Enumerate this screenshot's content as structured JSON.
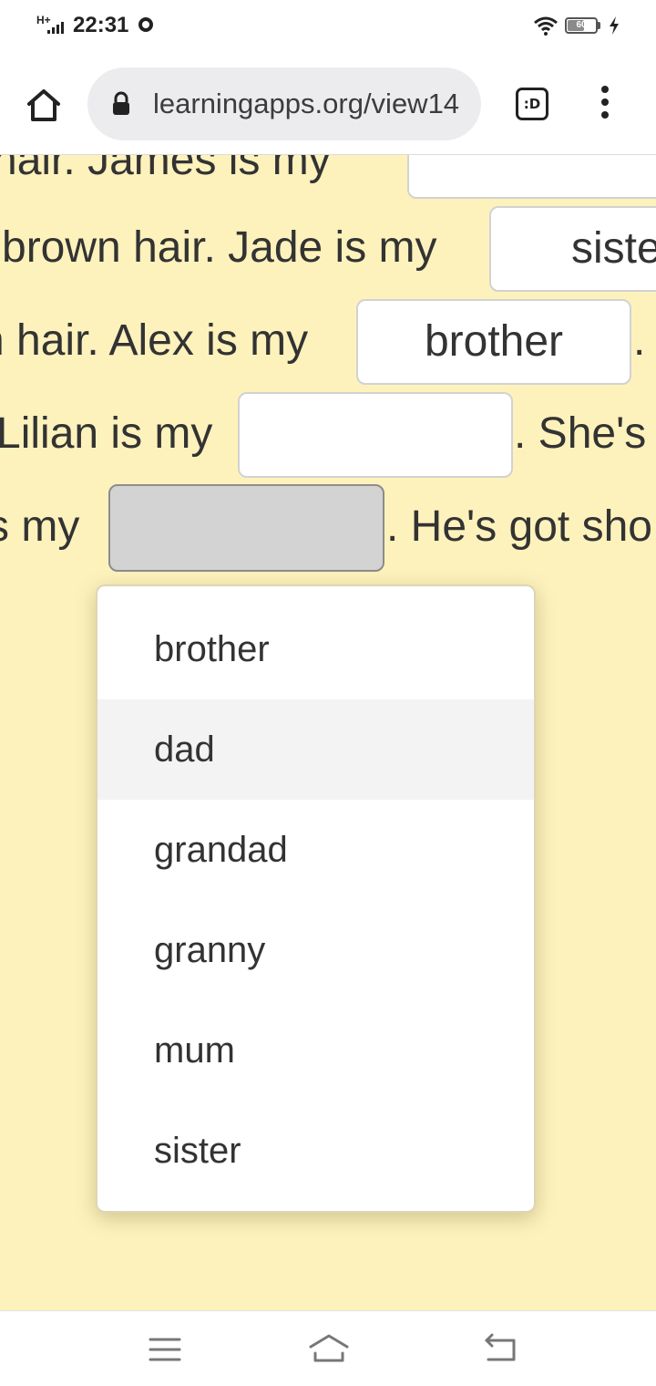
{
  "status_bar": {
    "network": "H+",
    "time": "22:31",
    "battery_level": "60",
    "icons": [
      "signal-icon",
      "app-notification-icon",
      "wifi-icon",
      "battery-icon",
      "charging-icon"
    ]
  },
  "browser": {
    "url": "learningapps.org/view14",
    "tabs_label": ":D",
    "icons": [
      "home-icon",
      "lock-icon",
      "tab-switcher-icon",
      "overflow-menu-icon"
    ]
  },
  "exercise": {
    "lines": [
      {
        "before": "hair. James is my",
        "gap_value": "",
        "after": ""
      },
      {
        "before": "brown hair. Jade is my",
        "gap_value": "sister",
        "after": ""
      },
      {
        "before": "n hair. Alex is my",
        "gap_value": "brother",
        "after": "."
      },
      {
        "before": "Lilian is my",
        "gap_value": "",
        "after": ". She's"
      },
      {
        "before": "s my",
        "gap_value": "",
        "after": ". He's got sho"
      }
    ]
  },
  "dropdown": {
    "options": [
      "brother",
      "dad",
      "grandad",
      "granny",
      "mum",
      "sister"
    ],
    "highlighted": "dad"
  },
  "navigation": {
    "icons": [
      "menu-icon",
      "home-icon",
      "back-icon"
    ]
  },
  "colors": {
    "page_background": "#fdf2bc",
    "active_gap": "#d3d3d3",
    "highlight_row": "#f3f3f3"
  }
}
